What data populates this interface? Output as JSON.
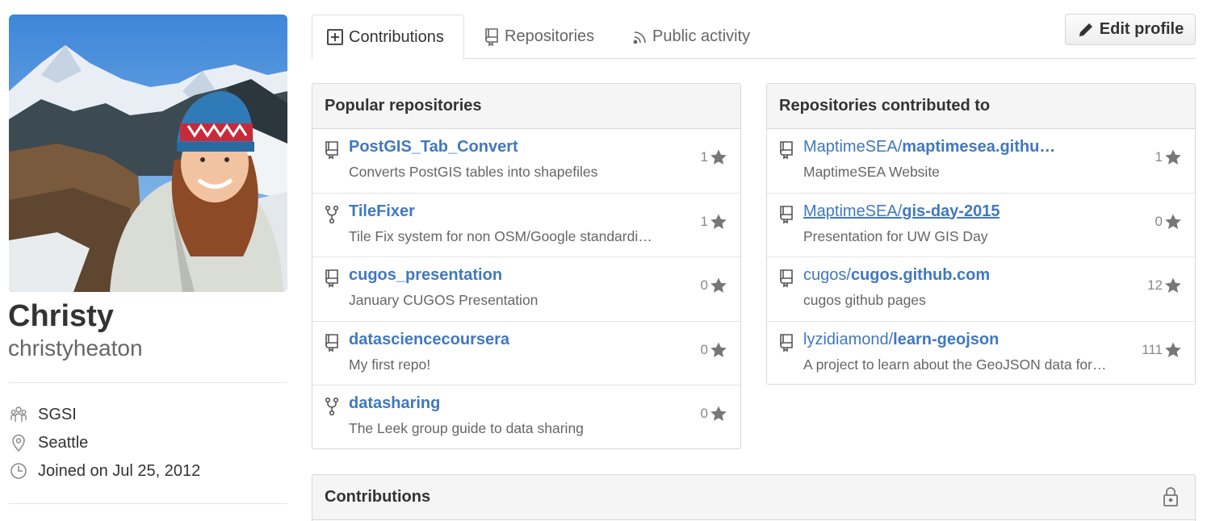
{
  "profile": {
    "fullname": "Christy",
    "username": "christyheaton",
    "organization": "SGSI",
    "location": "Seattle",
    "joined": "Joined on Jul 25, 2012"
  },
  "tabs": [
    {
      "label": "Contributions",
      "icon": "plus-square-icon",
      "selected": true
    },
    {
      "label": "Repositories",
      "icon": "repo-icon",
      "selected": false
    },
    {
      "label": "Public activity",
      "icon": "rss-icon",
      "selected": false
    }
  ],
  "edit_profile": {
    "label": "Edit profile",
    "icon": "pencil-icon"
  },
  "popular": {
    "title": "Popular repositories",
    "items": [
      {
        "name": "PostGIS_Tab_Convert",
        "description": "Converts PostGIS tables into shapefiles",
        "stars": "1",
        "icon": "repo-icon"
      },
      {
        "name": "TileFixer",
        "description": "Tile Fix system for non OSM/Google standardi…",
        "stars": "1",
        "icon": "fork-icon"
      },
      {
        "name": "cugos_presentation",
        "description": "January CUGOS Presentation",
        "stars": "0",
        "icon": "repo-icon"
      },
      {
        "name": "datasciencecoursera",
        "description": "My first repo!",
        "stars": "0",
        "icon": "repo-icon"
      },
      {
        "name": "datasharing",
        "description": "The Leek group guide to data sharing",
        "stars": "0",
        "icon": "fork-icon"
      }
    ]
  },
  "contributed": {
    "title": "Repositories contributed to",
    "items": [
      {
        "owner": "MaptimeSEA/",
        "name": "maptimesea.githu…",
        "description": "MaptimeSEA Website",
        "stars": "1"
      },
      {
        "owner": "MaptimeSEA/",
        "name": "gis-day-2015",
        "description": "Presentation for UW GIS Day",
        "stars": "0"
      },
      {
        "owner": "cugos/",
        "name": "cugos.github.com",
        "description": "cugos github pages",
        "stars": "12"
      },
      {
        "owner": "lyzidiamond/",
        "name": "learn-geojson",
        "description": "A project to learn about the GeoJSON data for…",
        "stars": "111"
      }
    ]
  },
  "contributions": {
    "title": "Contributions",
    "icon": "lock-icon"
  },
  "colors": {
    "link": "#4078c0",
    "text": "#333333",
    "muted": "#666666",
    "header_bg": "#f5f5f5"
  }
}
